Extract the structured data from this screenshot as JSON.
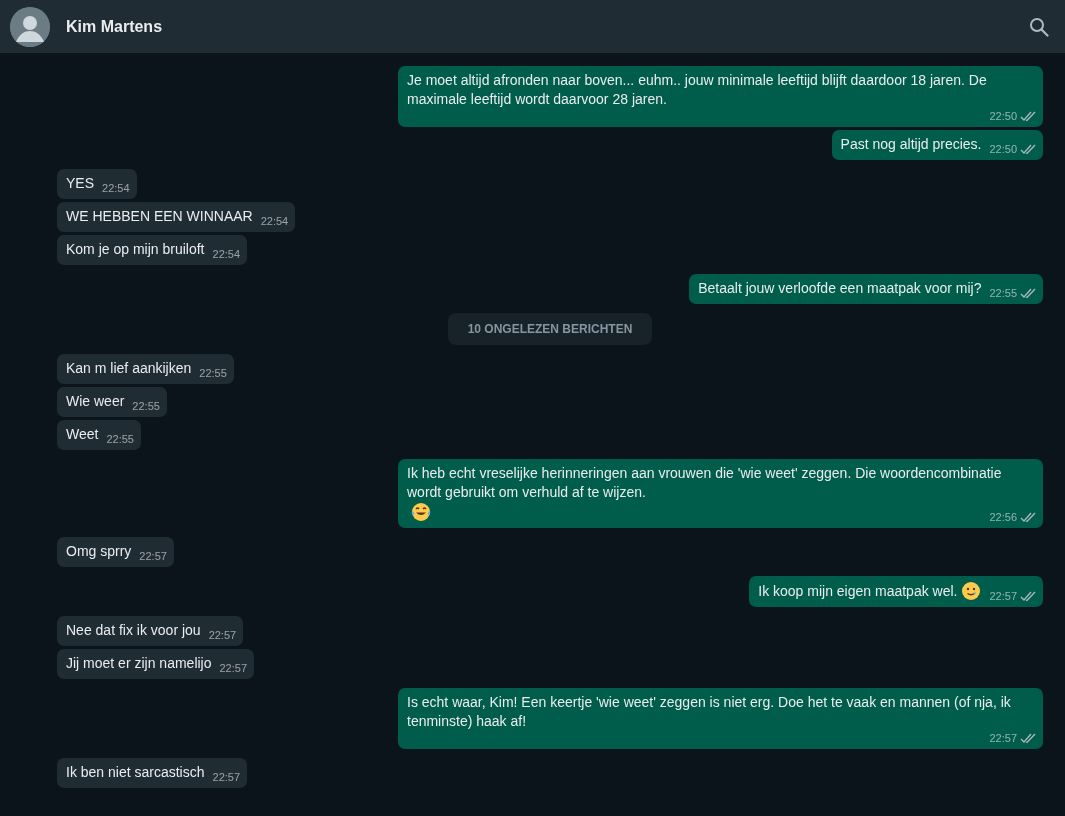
{
  "header": {
    "contact_name": "Kim Martens"
  },
  "messages": [
    {
      "kind": "message",
      "outgoing": true,
      "text": "Je moet altijd afronden naar boven... euhm.. jouw minimale leeftijd blijft daardoor 18 jaren. De maximale leeftijd wordt daarvoor 28 jaren.",
      "time": "22:50",
      "read": false
    },
    {
      "kind": "message",
      "outgoing": true,
      "text": "Past nog altijd precies.",
      "time": "22:50",
      "read": false
    },
    {
      "kind": "message",
      "outgoing": false,
      "text": "YES",
      "time": "22:54"
    },
    {
      "kind": "message",
      "outgoing": false,
      "text": "WE HEBBEN EEN WINNAAR",
      "time": "22:54"
    },
    {
      "kind": "message",
      "outgoing": false,
      "text": "Kom je op mijn bruiloft",
      "time": "22:54"
    },
    {
      "kind": "message",
      "outgoing": true,
      "text": "Betaalt jouw verloofde een maatpak voor mij?",
      "time": "22:55",
      "read": false
    },
    {
      "kind": "divider",
      "text": "10 ONGELEZEN BERICHTEN"
    },
    {
      "kind": "message",
      "outgoing": false,
      "text": "Kan m lief aankijken",
      "time": "22:55"
    },
    {
      "kind": "message",
      "outgoing": false,
      "text": "Wie weer",
      "time": "22:55"
    },
    {
      "kind": "message",
      "outgoing": false,
      "text": "Weet",
      "time": "22:55"
    },
    {
      "kind": "message",
      "outgoing": true,
      "text": "Ik heb echt vreselijke herinneringen aan vrouwen die 'wie weet' zeggen. Die woordencombinatie wordt gebruikt om verhuld af te wijzen.",
      "emoji": {
        "kind": "laughing"
      },
      "time": "22:56",
      "read": false
    },
    {
      "kind": "message",
      "outgoing": false,
      "text": "Omg sprry",
      "time": "22:57"
    },
    {
      "kind": "message",
      "outgoing": true,
      "text": "Ik koop mijn eigen maatpak wel.",
      "emoji": {
        "kind": "teary"
      },
      "time": "22:57",
      "read": false
    },
    {
      "kind": "message",
      "outgoing": false,
      "text": "Nee dat fix ik voor jou",
      "time": "22:57"
    },
    {
      "kind": "message",
      "outgoing": false,
      "text": "Jij moet er zijn namelijo",
      "time": "22:57"
    },
    {
      "kind": "message",
      "outgoing": true,
      "text": "Is echt waar, Kim! Een keertje 'wie weet' zeggen is niet erg. Doe het te vaak en mannen (of nja, ik tenminste) haak af!",
      "time": "22:57",
      "read": false
    },
    {
      "kind": "message",
      "outgoing": false,
      "text": "Ik ben niet sarcastisch",
      "time": "22:57"
    }
  ]
}
